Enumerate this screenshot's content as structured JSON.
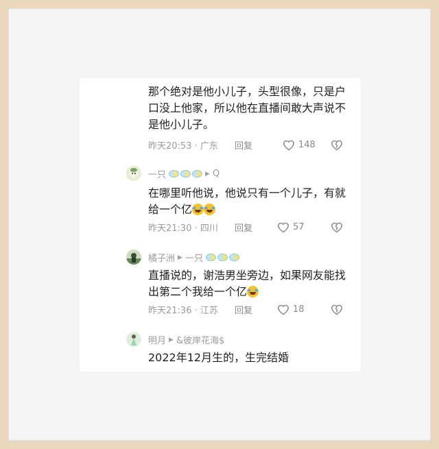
{
  "comments": [
    {
      "user": "",
      "reply_to": "",
      "text": "那个绝对是他小儿子，头型很像，只是户口没上他家，所以他在直播间敢大声说不是他小儿子。",
      "time": "昨天20:53 · 广东",
      "reply_label": "回复",
      "likes": "148"
    },
    {
      "user": "一只",
      "reply_to": "Q",
      "text": "在哪里听他说，他说只有一个儿子，有就给一个亿",
      "time": "昨天21:30 · 四川",
      "reply_label": "回复",
      "likes": "57"
    },
    {
      "user": "橘子洲",
      "reply_to": "一只",
      "text": "直播说的，谢浩男坐旁边，如果网友能找出第二个我给一个亿",
      "time": "昨天21:36 · 江苏",
      "reply_label": "回复",
      "likes": "18"
    },
    {
      "user": "明月",
      "reply_to": "&彼岸花海$",
      "text": "2022年12月生的，生完结婚",
      "time": "",
      "reply_label": "",
      "likes": ""
    }
  ],
  "icons": [
    "heart-icon",
    "broken-heart-icon",
    "reply-arrow-icon",
    "fish-badge-icon",
    "laughing-crying-emoji"
  ],
  "colors": {
    "frame": "#e9d8bd",
    "mat": "#f4f4f4",
    "text": "#1f1f1f",
    "meta": "#9a9a9a"
  }
}
